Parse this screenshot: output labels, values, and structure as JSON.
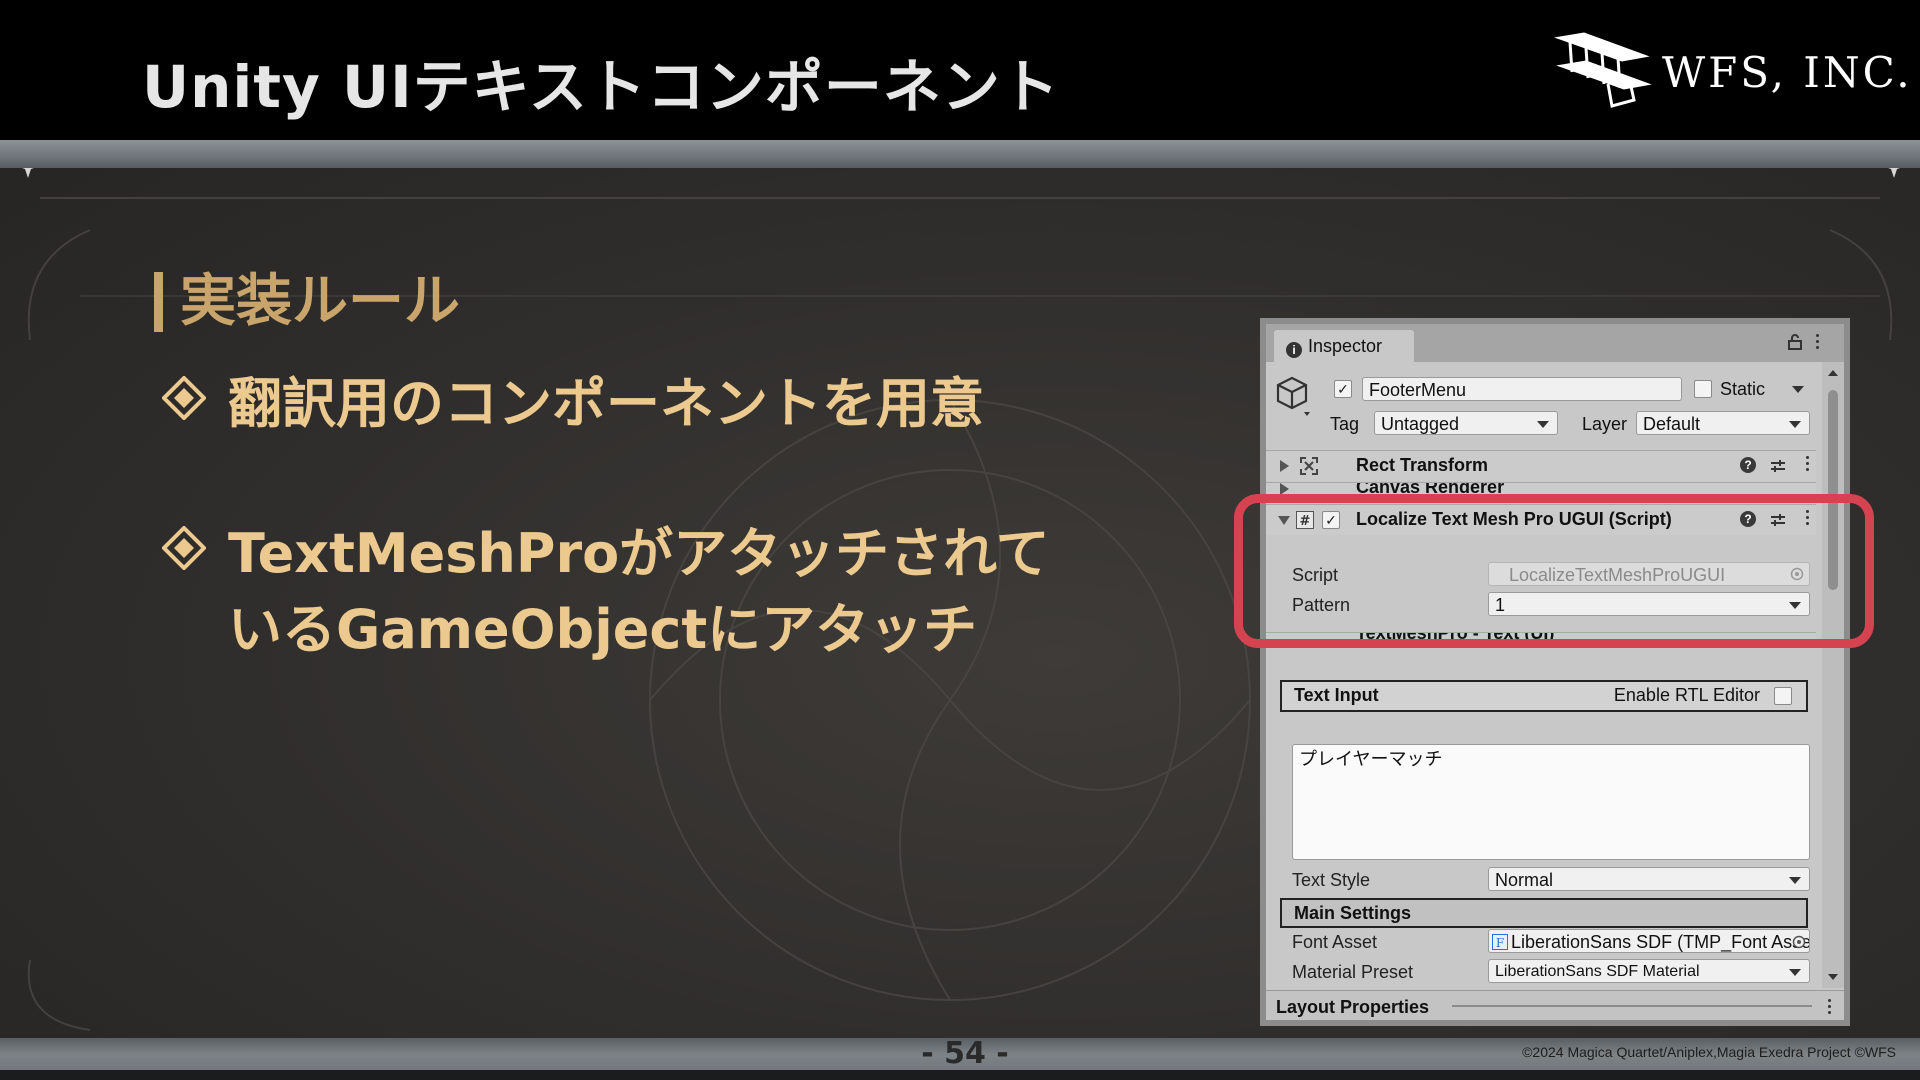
{
  "slide": {
    "title": "Unity UIテキストコンポーネント",
    "logo_text": "WFS, INC.",
    "section": "実装ルール",
    "bullet1": "翻訳用のコンポーネントを用意",
    "bullet2_line1": "TextMeshProがアタッチされて",
    "bullet2_line2": "いるGameObjectにアタッチ",
    "page_number": "- 54 -",
    "copyright": "©2024 Magica Quartet/Aniplex,Magia Exedra Project ©WFS"
  },
  "inspector": {
    "tab_label": "Inspector",
    "object_name": "FooterMenu",
    "static_label": "Static",
    "tag_label": "Tag",
    "tag_value": "Untagged",
    "layer_label": "Layer",
    "layer_value": "Default",
    "rect_transform": "Rect Transform",
    "canvas_renderer": "Canvas Renderer",
    "localize_title": "Localize Text Mesh Pro UGUI (Script)",
    "script_label": "Script",
    "script_value": "LocalizeTextMeshProUGUI",
    "pattern_label": "Pattern",
    "pattern_value": "1",
    "tmp_title": "TextMeshPro - Text (UI)",
    "text_input_label": "Text Input",
    "rtl_label": "Enable RTL Editor",
    "text_value": "プレイヤーマッチ",
    "text_style_label": "Text Style",
    "text_style_value": "Normal",
    "main_settings": "Main Settings",
    "font_asset_label": "Font Asset",
    "font_asset_value": "LiberationSans SDF (TMP_Font Asset)",
    "material_preset_label": "Material Preset",
    "material_preset_value": "LiberationSans SDF Material",
    "layout_properties": "Layout Properties"
  },
  "colors": {
    "heading_gold": "#c9a56c",
    "bullet_gold": "#ecca8f",
    "highlight_red": "#d4434f"
  }
}
